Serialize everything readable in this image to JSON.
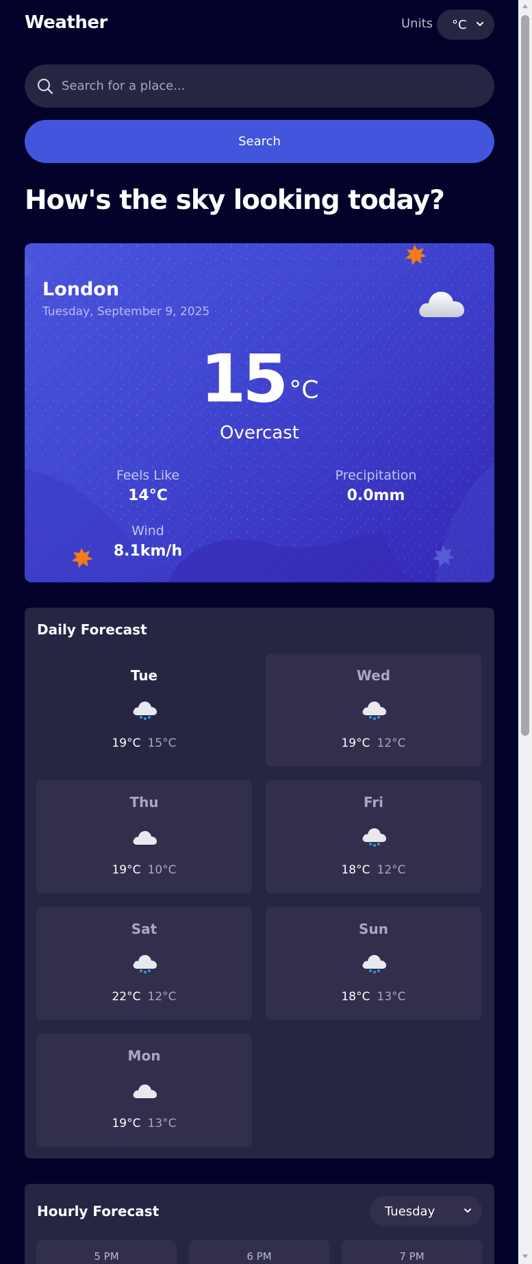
{
  "header": {
    "app_title": "Weather",
    "units_label": "Units",
    "units_value": "°C"
  },
  "search": {
    "placeholder": "Search for a place...",
    "button_label": "Search"
  },
  "hero_title": "How's the sky looking today?",
  "current": {
    "city": "London",
    "date": "Tuesday, September 9, 2025",
    "temperature": "15",
    "unit": "°C",
    "condition": "Overcast",
    "icon": "overcast-cloud-icon",
    "stats": {
      "feels_like": {
        "label": "Feels Like",
        "value": "14°C"
      },
      "precipitation": {
        "label": "Precipitation",
        "value": "0.0mm"
      },
      "wind": {
        "label": "Wind",
        "value": "8.1km/h"
      }
    }
  },
  "daily": {
    "title": "Daily Forecast",
    "days": [
      {
        "day": "Tue",
        "high": "19°C",
        "low": "15°C",
        "icon": "rain-cloud-icon",
        "selected": true
      },
      {
        "day": "Wed",
        "high": "19°C",
        "low": "12°C",
        "icon": "rain-cloud-icon"
      },
      {
        "day": "Thu",
        "high": "19°C",
        "low": "10°C",
        "icon": "cloud-icon"
      },
      {
        "day": "Fri",
        "high": "18°C",
        "low": "12°C",
        "icon": "rain-cloud-icon"
      },
      {
        "day": "Sat",
        "high": "22°C",
        "low": "12°C",
        "icon": "rain-cloud-icon"
      },
      {
        "day": "Sun",
        "high": "18°C",
        "low": "13°C",
        "icon": "rain-cloud-icon"
      },
      {
        "day": "Mon",
        "high": "19°C",
        "low": "13°C",
        "icon": "cloud-icon"
      }
    ]
  },
  "hourly": {
    "title": "Hourly Forecast",
    "selected_day": "Tuesday",
    "hours": [
      "5 PM",
      "6 PM",
      "7 PM"
    ]
  },
  "colors": {
    "page_bg": "#03022a",
    "panel_bg": "#262542",
    "card_bg": "#312f4c",
    "accent": "#4355dc",
    "hero_gradient_start": "#4a54dc",
    "hero_gradient_end": "#3527b5",
    "star_orange": "#f47b16"
  }
}
